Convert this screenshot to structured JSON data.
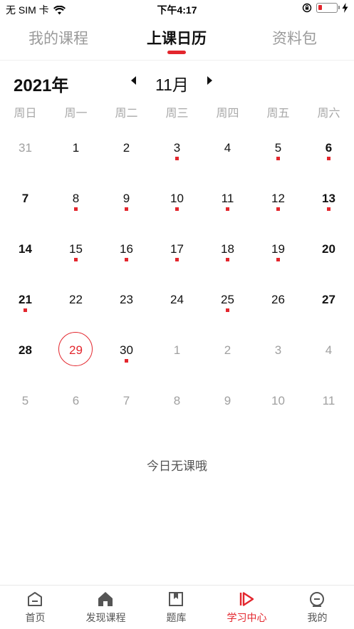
{
  "status_bar": {
    "carrier": "无 SIM 卡",
    "time": "下午4:17",
    "wifi_icon": "wifi-icon",
    "orientation_lock_icon": "orientation-lock-icon",
    "charging_icon": "charging-bolt-icon",
    "battery_level": 0.15
  },
  "tabs": [
    {
      "label": "我的课程",
      "active": false
    },
    {
      "label": "上课日历",
      "active": true
    },
    {
      "label": "资料包",
      "active": false
    }
  ],
  "calendar": {
    "year_label": "2021年",
    "month_label": "11月",
    "weekdays": [
      "周日",
      "周一",
      "周二",
      "周三",
      "周四",
      "周五",
      "周六"
    ],
    "weeks": [
      [
        {
          "d": "31",
          "o": true
        },
        {
          "d": "1"
        },
        {
          "d": "2"
        },
        {
          "d": "3",
          "c": true
        },
        {
          "d": "4"
        },
        {
          "d": "5",
          "c": true
        },
        {
          "d": "6",
          "c": true
        }
      ],
      [
        {
          "d": "7"
        },
        {
          "d": "8",
          "c": true
        },
        {
          "d": "9",
          "c": true
        },
        {
          "d": "10",
          "c": true
        },
        {
          "d": "11",
          "c": true
        },
        {
          "d": "12",
          "c": true
        },
        {
          "d": "13",
          "c": true
        }
      ],
      [
        {
          "d": "14"
        },
        {
          "d": "15",
          "c": true
        },
        {
          "d": "16",
          "c": true
        },
        {
          "d": "17",
          "c": true
        },
        {
          "d": "18",
          "c": true
        },
        {
          "d": "19",
          "c": true
        },
        {
          "d": "20"
        }
      ],
      [
        {
          "d": "21",
          "c": true
        },
        {
          "d": "22"
        },
        {
          "d": "23"
        },
        {
          "d": "24"
        },
        {
          "d": "25",
          "c": true
        },
        {
          "d": "26"
        },
        {
          "d": "27"
        }
      ],
      [
        {
          "d": "28"
        },
        {
          "d": "29",
          "t": true
        },
        {
          "d": "30",
          "c": true
        },
        {
          "d": "1",
          "o": true
        },
        {
          "d": "2",
          "o": true
        },
        {
          "d": "3",
          "o": true
        },
        {
          "d": "4",
          "o": true
        }
      ],
      [
        {
          "d": "5",
          "o": true
        },
        {
          "d": "6",
          "o": true
        },
        {
          "d": "7",
          "o": true
        },
        {
          "d": "8",
          "o": true
        },
        {
          "d": "9",
          "o": true
        },
        {
          "d": "10",
          "o": true
        },
        {
          "d": "11",
          "o": true
        }
      ]
    ],
    "empty_message": "今日无课哦"
  },
  "bottom_nav": [
    {
      "label": "首页",
      "icon": "home-icon",
      "active": false
    },
    {
      "label": "发现课程",
      "icon": "discover-house-icon",
      "active": false
    },
    {
      "label": "题库",
      "icon": "question-bank-icon",
      "active": false
    },
    {
      "label": "学习中心",
      "icon": "play-learning-icon",
      "active": true
    },
    {
      "label": "我的",
      "icon": "profile-icon",
      "active": false
    }
  ],
  "colors": {
    "accent": "#e3262d",
    "muted": "#a0a0a0"
  }
}
